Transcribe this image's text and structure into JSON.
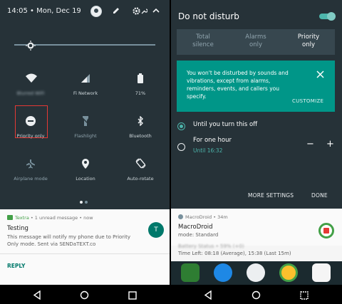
{
  "left": {
    "status": {
      "time": "14:05",
      "date": "Mon, Dec 19"
    },
    "tiles": [
      {
        "label": "Blurred WiFi",
        "state": "on"
      },
      {
        "label": "Fi Network",
        "state": "on"
      },
      {
        "label": "71%",
        "state": "on"
      },
      {
        "label": "Priority only",
        "state": "on"
      },
      {
        "label": "Flashlight",
        "state": "off"
      },
      {
        "label": "Bluetooth",
        "state": "on"
      },
      {
        "label": "Airplane mode",
        "state": "off"
      },
      {
        "label": "Location",
        "state": "on"
      },
      {
        "label": "Auto-rotate",
        "state": "on"
      }
    ],
    "brightness_level": 0.08,
    "notification": {
      "app": "Textra",
      "meta": " • 1 unread message • now",
      "title": "Testing",
      "body": "This message will notify my phone due to Priority Only mode. Sent via SENDaTEXT.co",
      "avatar_letter": "T",
      "action": "REPLY"
    }
  },
  "right": {
    "title": "Do not disturb",
    "toggle_on": true,
    "segments": [
      {
        "line1": "Total",
        "line2": "silence",
        "active": false
      },
      {
        "line1": "Alarms",
        "line2": "only",
        "active": false
      },
      {
        "line1": "Priority",
        "line2": "only",
        "active": true
      }
    ],
    "info_text": "You won't be disturbed by sounds and vibrations, except from alarms, reminders, events, and callers you specify.",
    "customize": "CUSTOMIZE",
    "option1": "Until you turn this off",
    "option2": "For one hour",
    "option2_sub": "Until 16:32",
    "minus": "−",
    "plus": "+",
    "more_settings": "MORE SETTINGS",
    "done": "DONE",
    "notification": {
      "app": "MacroDroid",
      "time": " • 34m",
      "title": "MacroDroid",
      "sub": "mode: Standard",
      "partial": "Battery Status • 59% (+0)",
      "time_left": "Time Left: 08:18 (Average), 15:38 (Last 15m)"
    }
  },
  "colors": {
    "panel_bg": "#263238",
    "accent": "#009688",
    "accent_light": "#4db6ac",
    "highlight_box": "#e53935"
  }
}
